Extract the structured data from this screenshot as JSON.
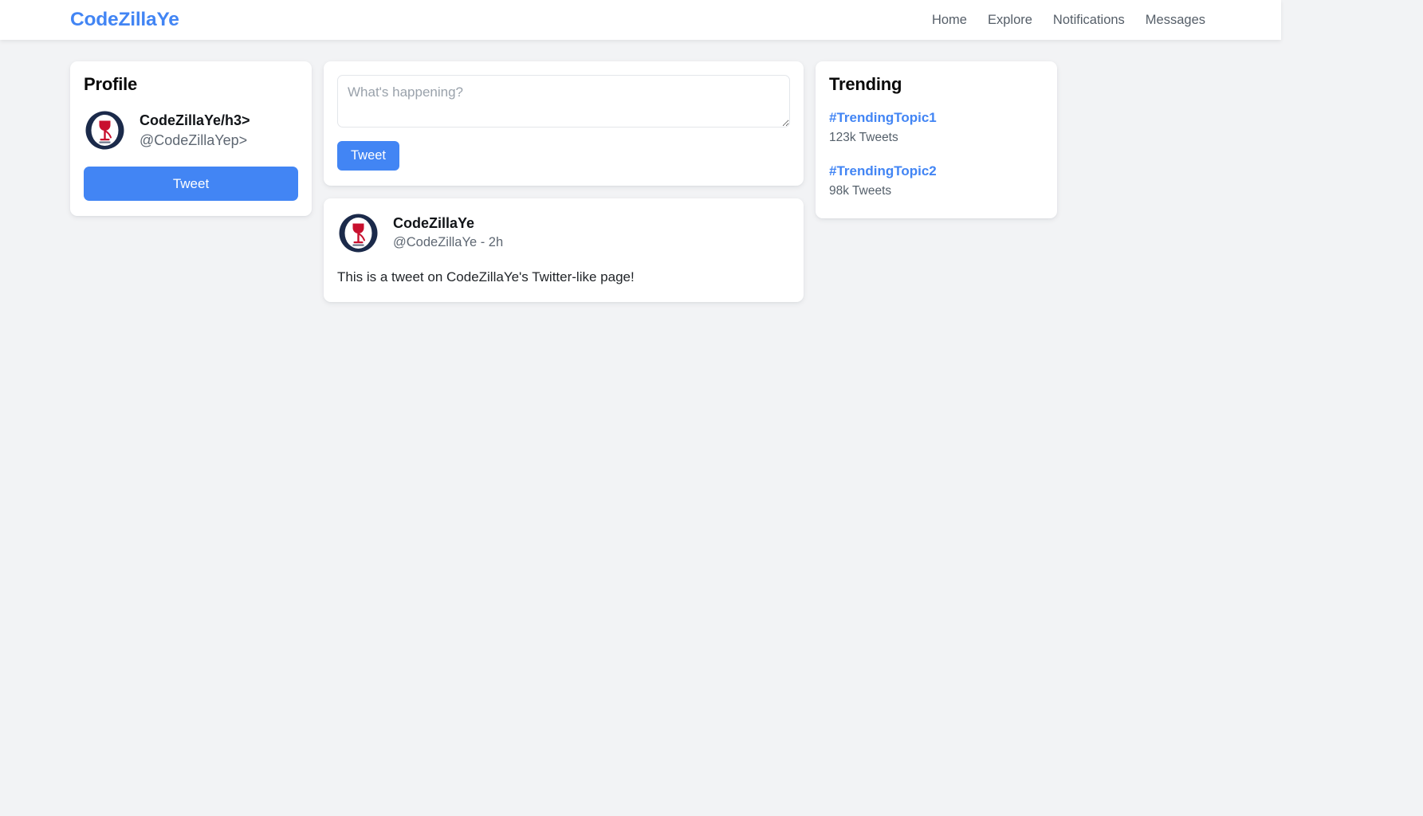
{
  "navbar": {
    "brand": "CodeZillaYe",
    "links": [
      {
        "label": "Home"
      },
      {
        "label": "Explore"
      },
      {
        "label": "Notifications"
      },
      {
        "label": "Messages"
      }
    ]
  },
  "profile": {
    "title": "Profile",
    "name": "CodeZillaYe/h3>",
    "handle": "@CodeZillaYep>",
    "tweet_button": "Tweet"
  },
  "compose": {
    "placeholder": "What's happening?",
    "value": "",
    "tweet_button": "Tweet"
  },
  "feed": {
    "tweets": [
      {
        "author": "CodeZillaYe",
        "sub": "@CodeZillaYe - 2h",
        "text": "This is a tweet on CodeZillaYe's Twitter-like page!"
      }
    ]
  },
  "trending": {
    "title": "Trending",
    "items": [
      {
        "tag": "#TrendingTopic1",
        "count": "123k Tweets"
      },
      {
        "tag": "#TrendingTopic2",
        "count": "98k Tweets"
      }
    ]
  },
  "colors": {
    "accent": "#4285f4",
    "page_background": "#f2f3f5",
    "card_background": "#ffffff",
    "avatar_ring": "#1b2a4a",
    "avatar_mark": "#c8102e",
    "muted_text": "#5e6772"
  },
  "icons": {
    "avatar": "codezillaye-logo-icon",
    "resize": "resize-handle-icon"
  }
}
